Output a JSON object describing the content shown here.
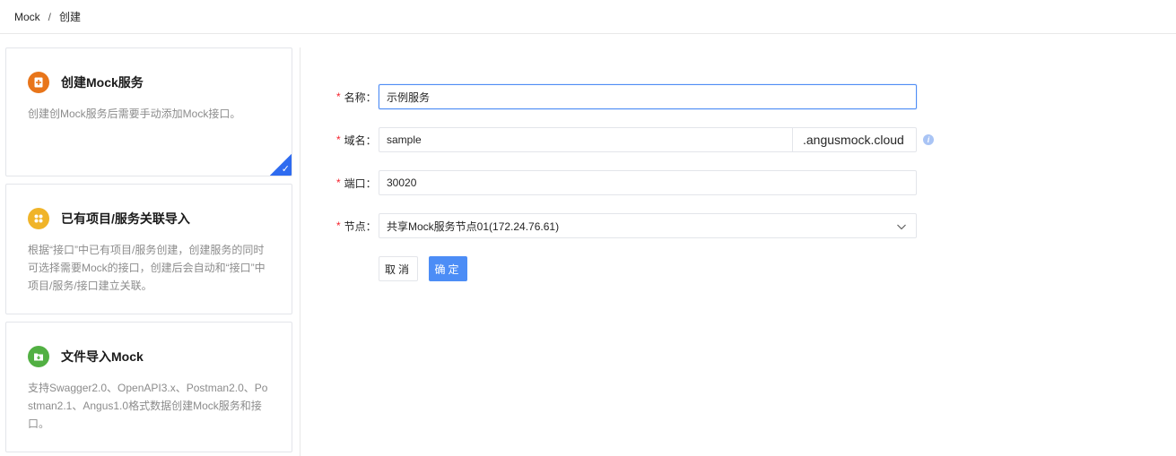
{
  "breadcrumb": {
    "root": "Mock",
    "separator": "/",
    "current": "创建"
  },
  "cards": [
    {
      "title": "创建Mock服务",
      "desc_lines": [
        "创建创Mock服务后需要手动添加Mock接口。"
      ],
      "icon": "plus-file-icon",
      "icon_color": "#e8751a",
      "selected": true,
      "check": "✓"
    },
    {
      "title": "已有项目/服务关联导入",
      "desc_lines": [
        "根据“接口”中已有项目/服务创建，创建服务的同时",
        "可选择需要Mock的接口，创建后会自动和“接口”中",
        "项目/服务/接口建立关联。"
      ],
      "icon": "apps-icon",
      "icon_color": "#f0b429",
      "selected": false
    },
    {
      "title": "文件导入Mock",
      "desc_lines": [
        "支持Swagger2.0、OpenAPI3.x、Postman2.0、Po",
        "stman2.1、Angus1.0格式数据创建Mock服务和接",
        "口。"
      ],
      "icon": "file-import-icon",
      "icon_color": "#52b043",
      "selected": false
    }
  ],
  "form": {
    "required_mark": "*",
    "name": {
      "label": "名称：",
      "value": "示例服务"
    },
    "domain": {
      "label": "域名：",
      "value": "sample",
      "suffix": ".angusmock.cloud"
    },
    "port": {
      "label": "端口：",
      "value": "30020"
    },
    "node": {
      "label": "节点：",
      "value": "共享Mock服务节点01(172.24.76.61)"
    },
    "cancel_label": "取消",
    "ok_label": "确定"
  },
  "colors": {
    "primary": "#4c8df6",
    "required": "#f5222d",
    "selected_corner": "#2e6bf0"
  }
}
